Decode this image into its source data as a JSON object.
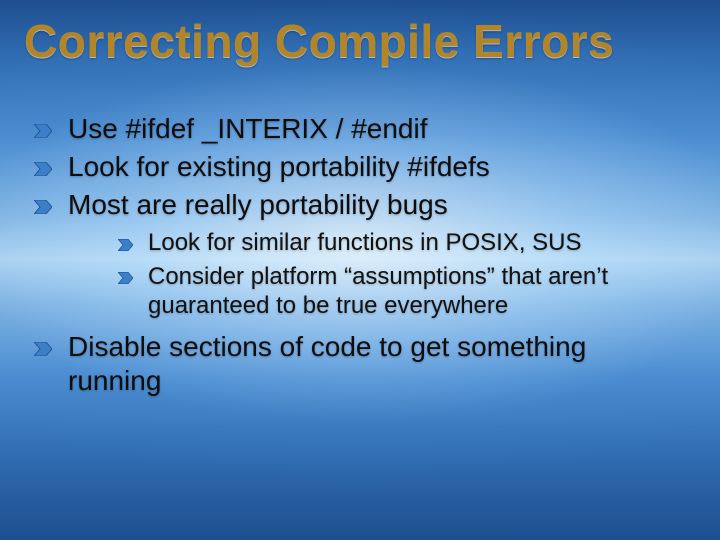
{
  "title": "Correcting Compile Errors",
  "bullets": {
    "b1": "Use #ifdef _INTERIX / #endif",
    "b2": "Look for existing portability #ifdefs",
    "b3": "Most are really portability bugs",
    "b3_sub": {
      "s1": "Look for similar functions in POSIX, SUS",
      "s2": "Consider platform “assumptions” that aren’t guaranteed to be true everywhere"
    },
    "b4": "Disable sections of code to get something running"
  },
  "colors": {
    "title": "#b28528",
    "bullet_fill": "#3a7fc8"
  }
}
